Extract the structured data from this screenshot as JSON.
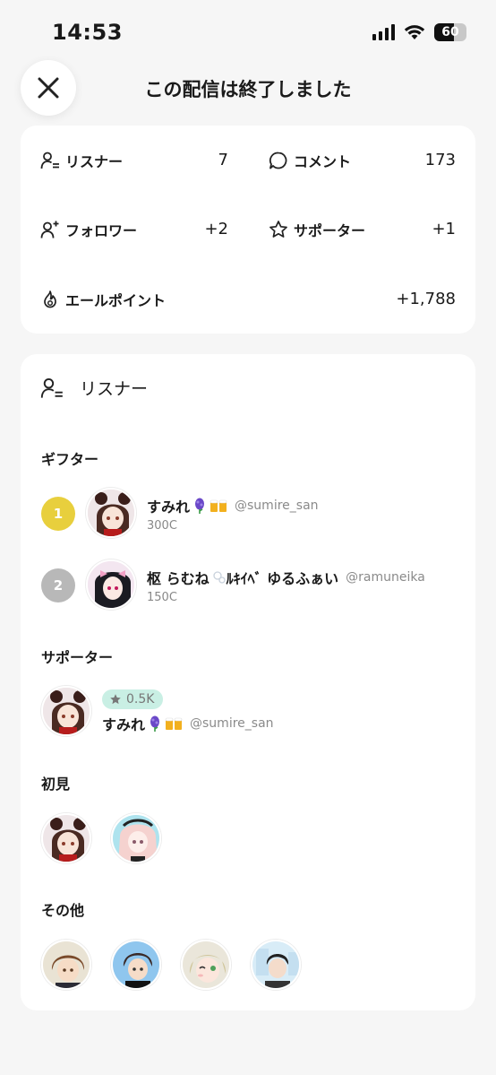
{
  "status_bar": {
    "time": "14:53",
    "battery": "60",
    "battery_level": 0.6
  },
  "header": {
    "title": "この配信は終了しました"
  },
  "stats": {
    "listeners_label": "リスナー",
    "listeners_value": "7",
    "comments_label": "コメント",
    "comments_value": "173",
    "followers_label": "フォロワー",
    "followers_value": "+2",
    "supporters_label": "サポーター",
    "supporters_value": "+1",
    "yell_label": "エールポイント",
    "yell_value": "+1,788"
  },
  "listeners": {
    "title": "リスナー",
    "gifters_title": "ギフター",
    "gifters": [
      {
        "rank": "1",
        "name": "すみれ",
        "handle": "@sumire_san",
        "coins": "300C",
        "rank_color": "#e8cf3d"
      },
      {
        "rank": "2",
        "name": "枢 らむね",
        "name_rest": "ﾙｷｲﾍﾞ ゆるふぁい",
        "handle": "@ramuneika",
        "coins": "150C",
        "rank_color": "#b8b8b8"
      }
    ],
    "supporters_title": "サポーター",
    "supporter": {
      "points": "0.5K",
      "name": "すみれ",
      "handle": "@sumire_san"
    },
    "first_time_title": "初見",
    "others_title": "その他"
  },
  "colors": {
    "support_pill": "#c9efe4",
    "gold": "#e8cf3d",
    "silver": "#b8b8b8"
  }
}
